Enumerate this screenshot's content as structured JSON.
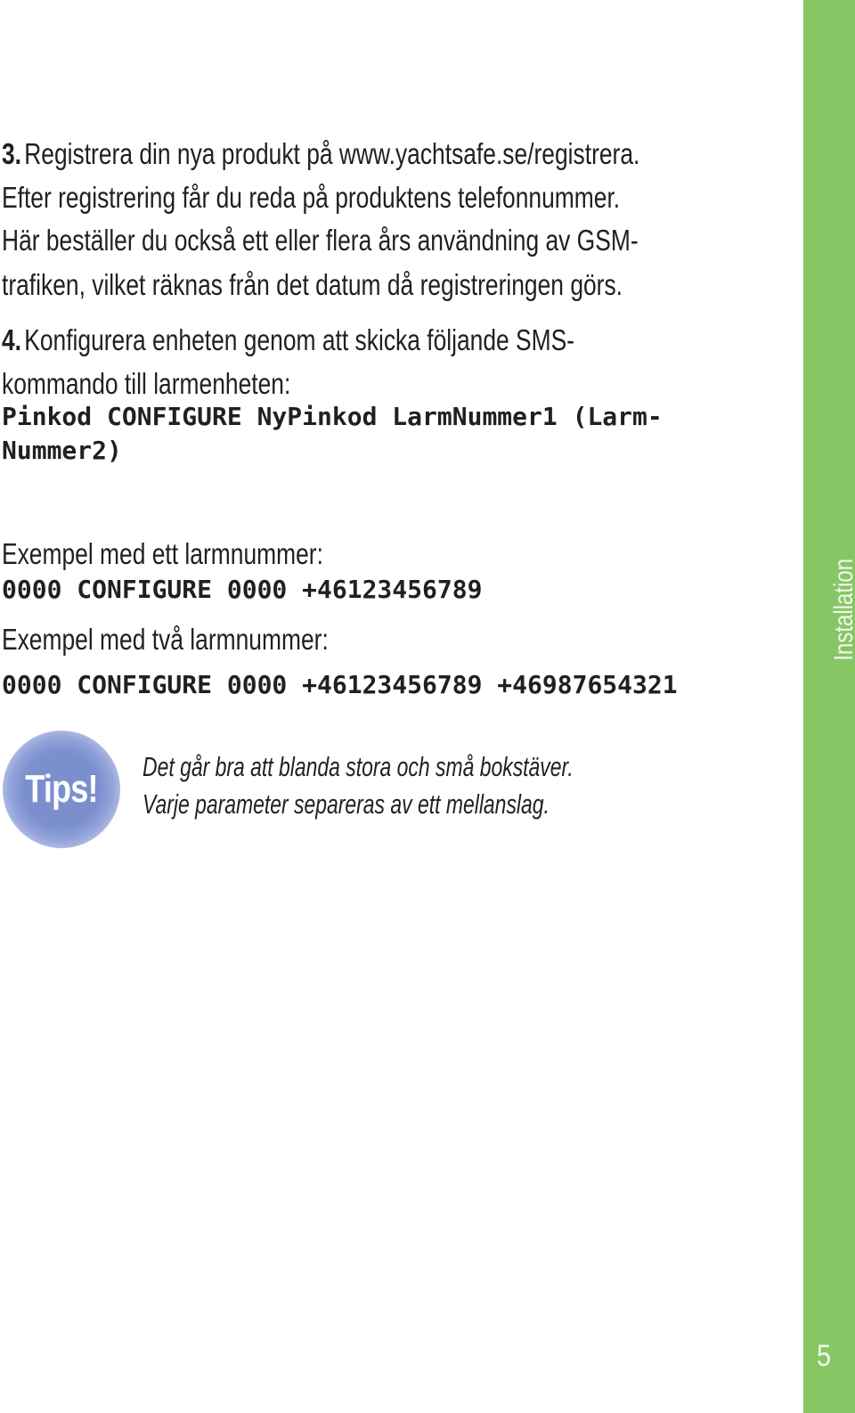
{
  "steps": [
    {
      "number": "3.",
      "lines": [
        "Registrera din nya produkt på www.yachtsafe.se/registrera.",
        "Efter registrering får du reda på produktens telefonnummer.",
        "Här beställer du också ett eller flera års användning av GSM-",
        "trafiken, vilket räknas från det datum då registreringen görs."
      ]
    },
    {
      "number": "4.",
      "lines": [
        "Konfigurera enheten genom att skicka följande SMS-",
        "kommando till larmenheten:"
      ],
      "command_lines": [
        "Pinkod CONFIGURE NyPinkod LarmNummer1 (Larm-",
        "Nummer2)"
      ]
    }
  ],
  "examples": [
    {
      "label": "Exempel med ett larmnummer:",
      "command": "0000 CONFIGURE 0000 +46123456789"
    },
    {
      "label": "Exempel med två larmnummer:",
      "command": "0000 CONFIGURE 0000 +46123456789 +46987654321"
    }
  ],
  "tips": {
    "badge_label": "Tips!",
    "badge_color": "#7b8fcf",
    "lines": [
      "Det går bra att blanda stora och små bokstäver.",
      "Varje parameter separeras av ett mellanslag."
    ]
  },
  "sidebar": {
    "section_label": "Installation",
    "page_number": "5",
    "color": "#86c665"
  }
}
